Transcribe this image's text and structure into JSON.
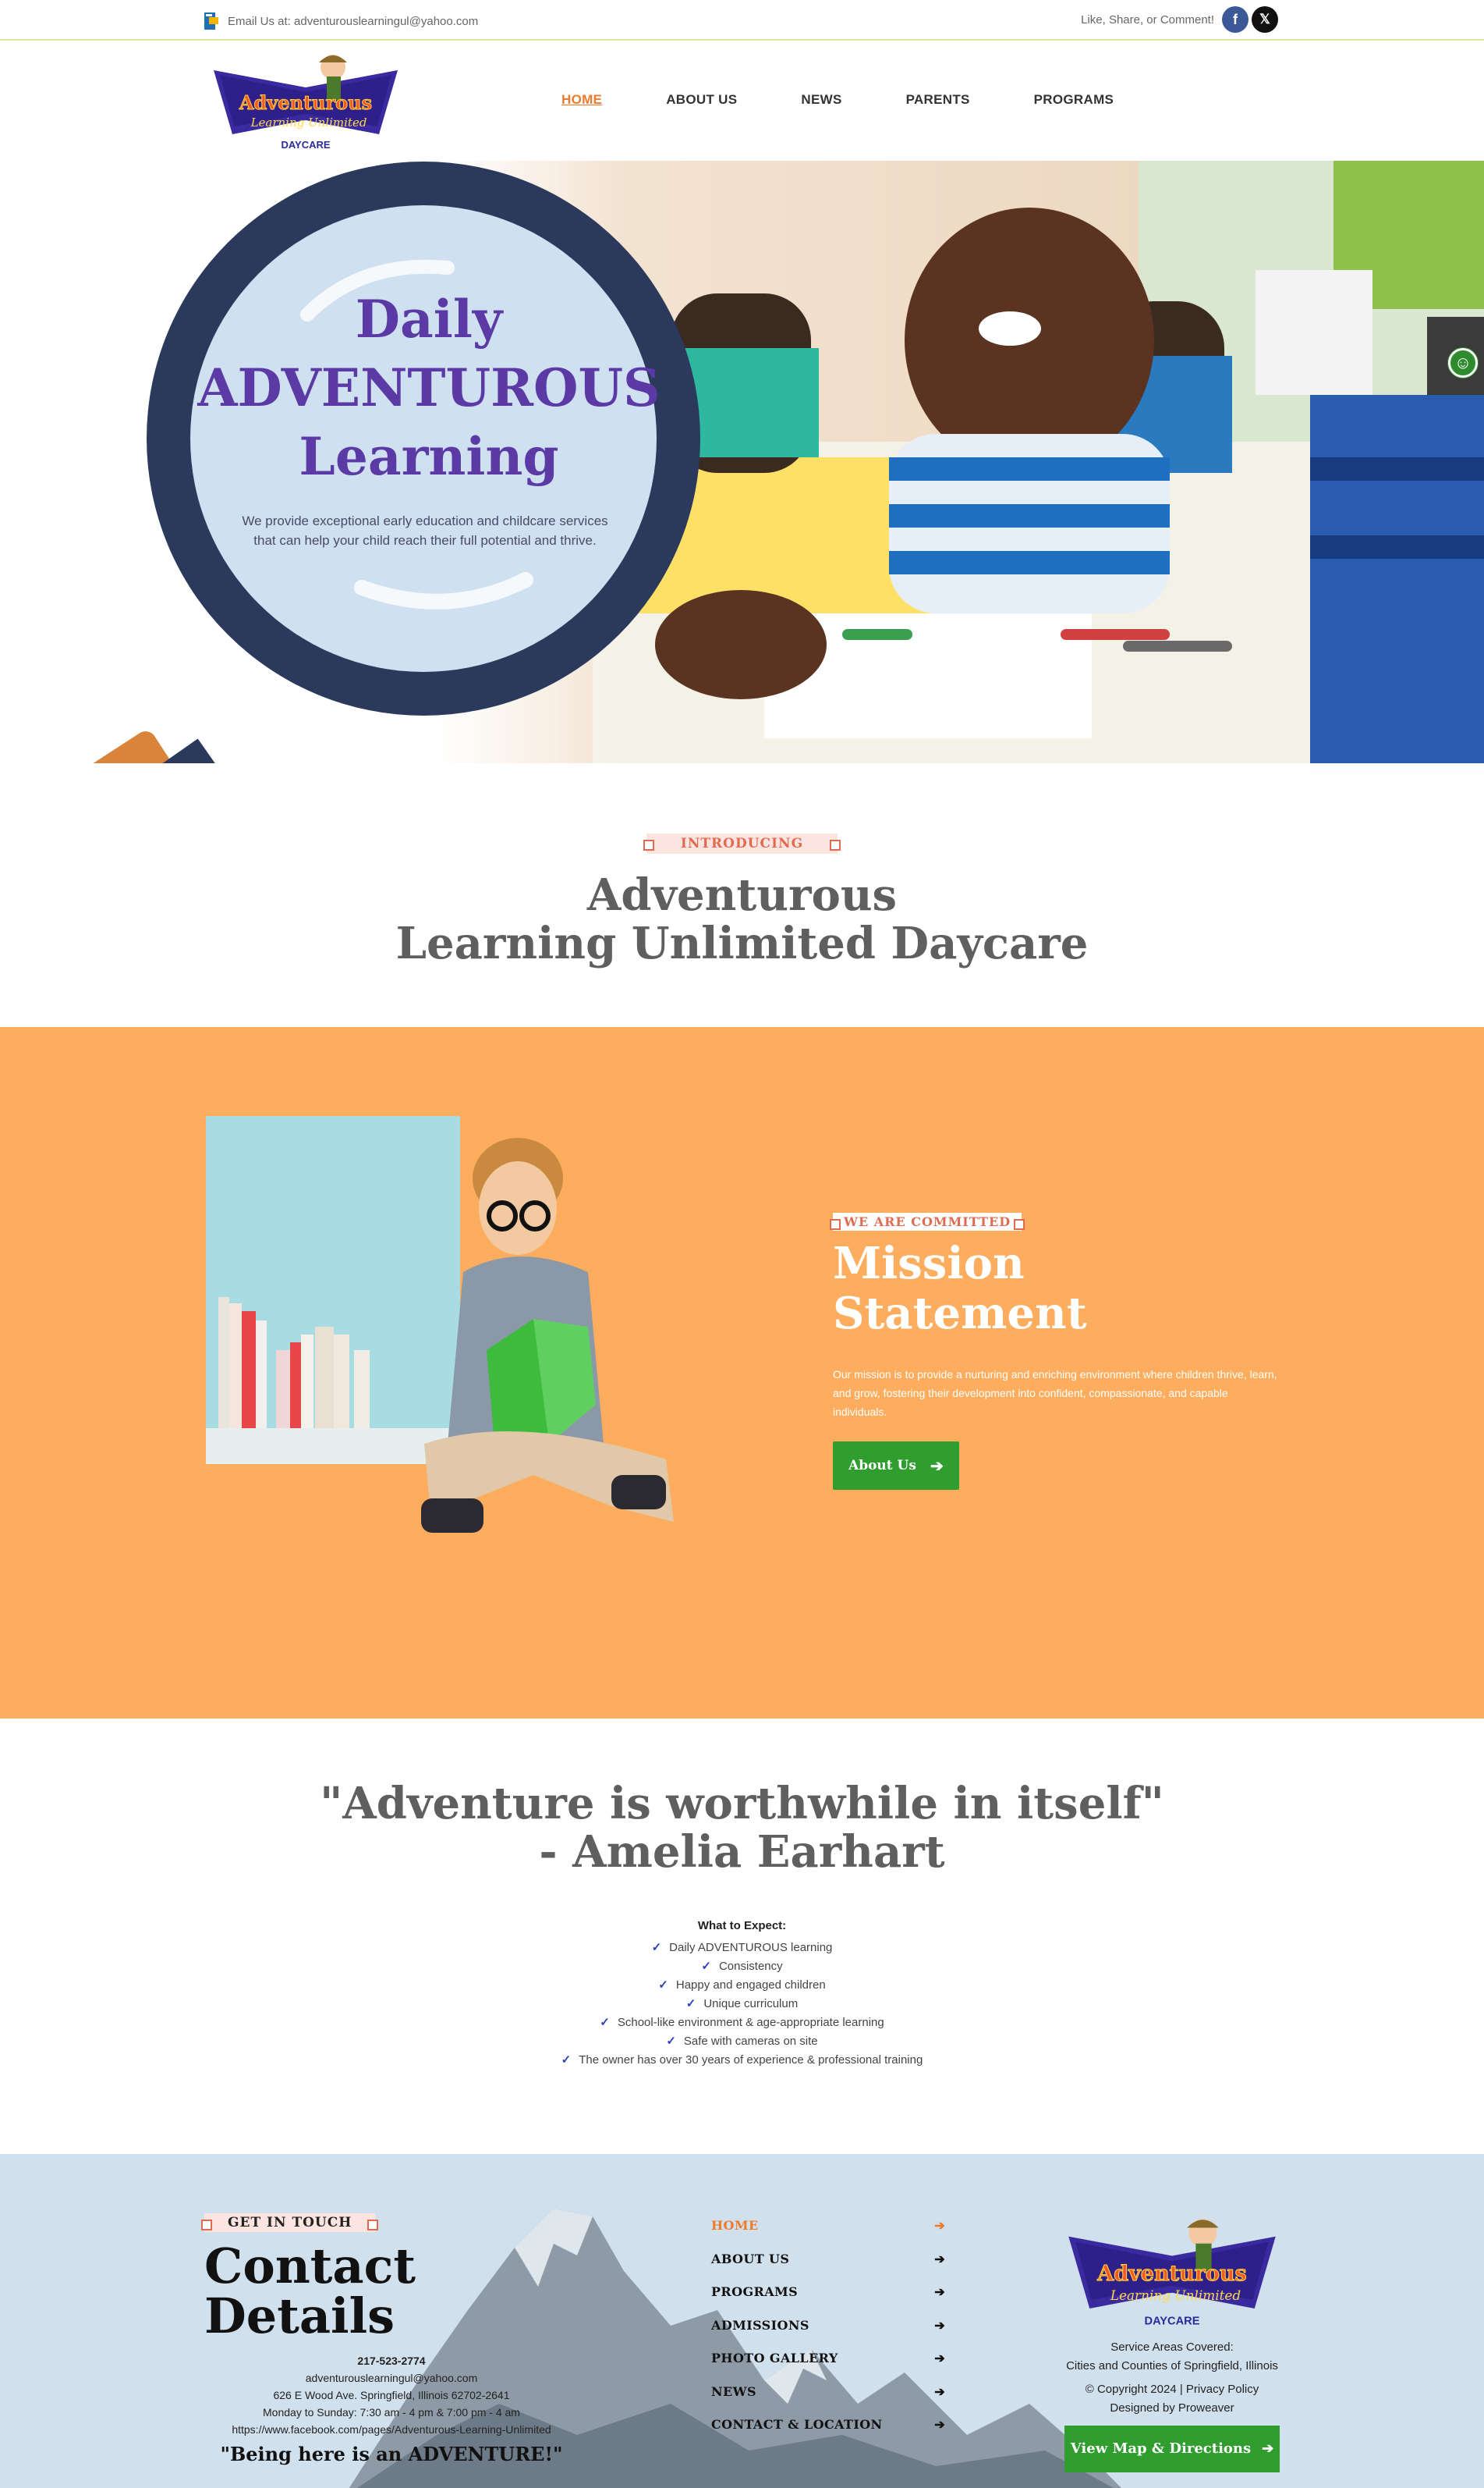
{
  "topbar": {
    "email_text": "Email Us at: adventurouslearningul@yahoo.com",
    "social_text": "Like, Share, or Comment!",
    "facebook_glyph": "f",
    "x_glyph": "𝕏"
  },
  "logo": {
    "line1": "Adventurous",
    "line2": "Learning Unlimited",
    "line3": "DAYCARE"
  },
  "nav": {
    "items": [
      "HOME",
      "ABOUT US",
      "NEWS",
      "PARENTS",
      "PROGRAMS"
    ],
    "active": "HOME"
  },
  "hero": {
    "title_line1": "Daily",
    "title_line2": "ADVENTUROUS",
    "title_line3": "Learning",
    "subtitle": "We provide exceptional early education and childcare services that can help your child reach their full potential and thrive."
  },
  "intro": {
    "tag": "INTRODUCING",
    "heading_line1": "Adventurous",
    "heading_line2": "Learning Unlimited Daycare"
  },
  "mission": {
    "tag": "WE ARE COMMITTED",
    "heading": "Mission Statement",
    "body": "Our mission is to provide a nurturing and enriching environment where children thrive, learn, and grow, fostering their development into confident, compassionate, and capable individuals.",
    "button_label": "About Us"
  },
  "quote": {
    "line1": "\"Adventure is worthwhile in itself\"",
    "line2": "- Amelia Earhart"
  },
  "expect": {
    "heading": "What to Expect:",
    "check_glyph": "✓",
    "items": [
      "Daily ADVENTUROUS learning",
      "Consistency",
      "Happy and engaged children",
      "Unique curriculum",
      "School-like environment & age-appropriate learning",
      "Safe with cameras on site",
      "The owner has over 30 years of experience & professional training"
    ]
  },
  "footer": {
    "tag": "GET IN TOUCH",
    "heading": "Contact Details",
    "phone": "217-523-2774",
    "email": "adventurouslearningul@yahoo.com",
    "address": "626 E Wood Ave. Springfield, Illinois 62702-2641",
    "hours": "Monday to Sunday: 7:30 am - 4 pm & 7:00 pm - 4 am",
    "facebook": "https://www.facebook.com/pages/Adventurous-Learning-Unlimited",
    "motto": "\"Being here is an ADVENTURE!\"",
    "nav": [
      "HOME",
      "ABOUT US",
      "PROGRAMS",
      "ADMISSIONS",
      "PHOTO GALLERY",
      "NEWS",
      "CONTACT & LOCATION"
    ],
    "nav_active": "HOME",
    "arrow_glyph": "➔",
    "service_label": "Service Areas Covered:",
    "service_area": "Cities and Counties of Springfield, Illinois",
    "copyright": "© Copyright 2024 | Privacy Policy",
    "designed_by": "Designed by Proweaver",
    "map_button": "View Map & Directions"
  },
  "colors": {
    "accent_orange": "#f07a2c",
    "mission_bg": "#fdad5d",
    "button_green": "#2f9e2f",
    "hero_title": "#5c3aa6",
    "footer_bg": "#d1e0ed"
  }
}
